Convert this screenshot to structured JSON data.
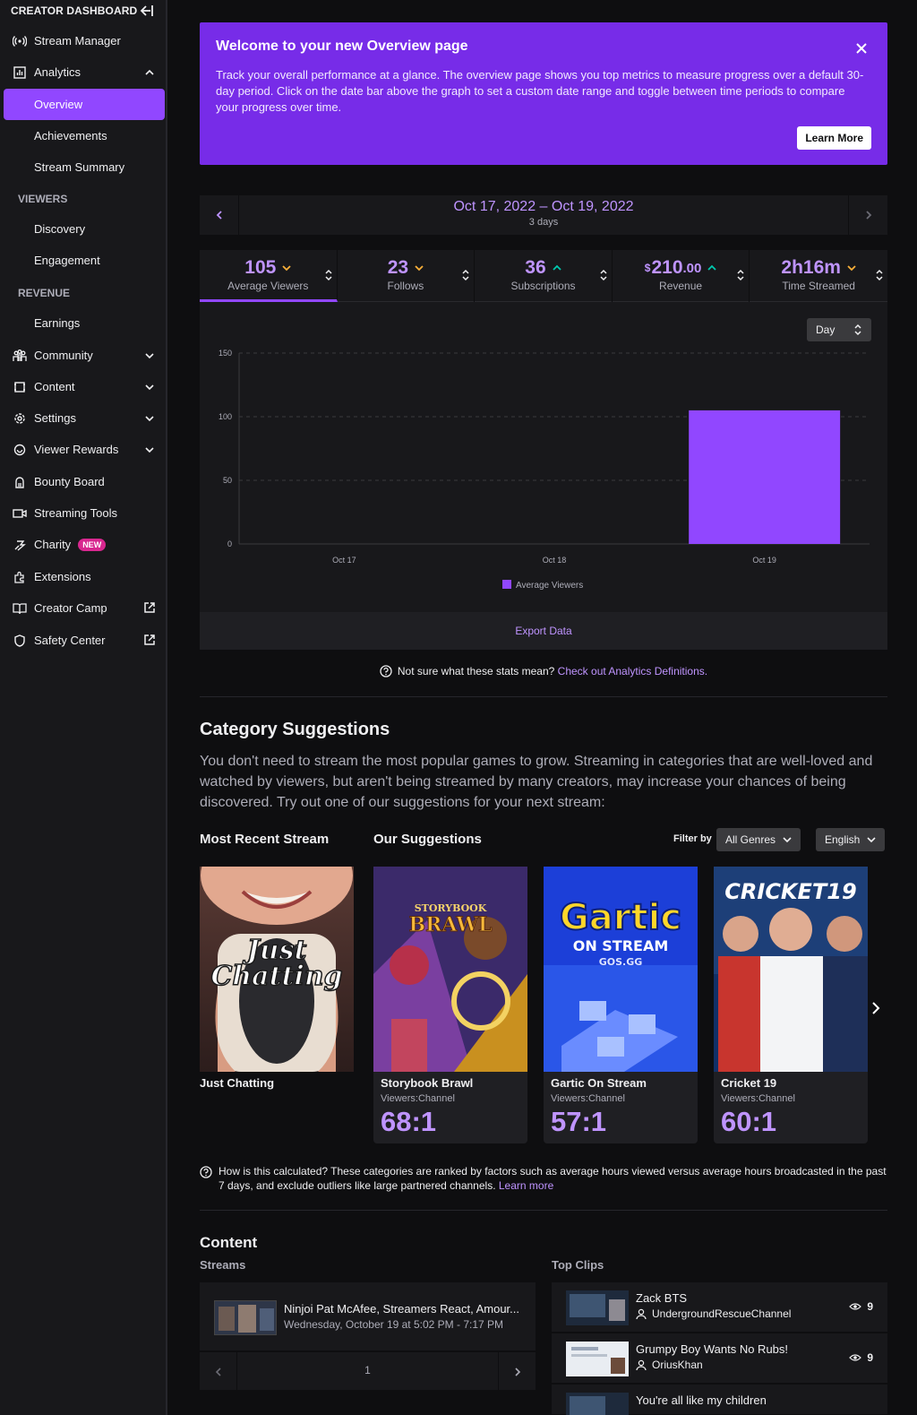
{
  "sidebar": {
    "title": "CREATOR DASHBOARD",
    "stream_manager": "Stream Manager",
    "analytics": "Analytics",
    "overview": "Overview",
    "achievements": "Achievements",
    "stream_summary": "Stream Summary",
    "viewers_cat": "VIEWERS",
    "discovery": "Discovery",
    "engagement": "Engagement",
    "revenue_cat": "REVENUE",
    "earnings": "Earnings",
    "community": "Community",
    "content": "Content",
    "settings": "Settings",
    "viewer_rewards": "Viewer Rewards",
    "bounty_board": "Bounty Board",
    "streaming_tools": "Streaming Tools",
    "charity": "Charity",
    "charity_badge": "NEW",
    "extensions": "Extensions",
    "creator_camp": "Creator Camp",
    "safety_center": "Safety Center"
  },
  "welcome": {
    "title": "Welcome to your new Overview page",
    "body": "Track your overall performance at a glance. The overview page shows you top metrics to measure progress over a default 30-day period. Click on the date bar above the graph to set a custom date range and toggle between time periods to compare your progress over time.",
    "learn_more": "Learn More"
  },
  "datebar": {
    "range": "Oct 17, 2022 – Oct 19, 2022",
    "days": "3 days"
  },
  "metrics": [
    {
      "value": "105",
      "label": "Average Viewers",
      "trend": "down"
    },
    {
      "value": "23",
      "label": "Follows",
      "trend": "down"
    },
    {
      "value": "36",
      "label": "Subscriptions",
      "trend": "up"
    },
    {
      "currency": "$",
      "value": "210",
      "decimals": ".00",
      "label": "Revenue",
      "trend": "up"
    },
    {
      "value": "2h16m",
      "label": "Time Streamed",
      "trend": "down"
    }
  ],
  "colors": {
    "accent": "#9147ff",
    "accent_light": "#bf94ff",
    "up": "#00c8af",
    "down": "#fab039"
  },
  "interval_select": "Day",
  "chart_data": {
    "type": "bar",
    "categories": [
      "Oct 17",
      "Oct 18",
      "Oct 19"
    ],
    "series": [
      {
        "name": "Average Viewers",
        "values": [
          0,
          0,
          105
        ]
      }
    ],
    "ylim": [
      0,
      150
    ],
    "yticks": [
      0,
      50,
      100,
      150
    ],
    "grid": true,
    "legend": "bottom"
  },
  "export_label": "Export Data",
  "help_stats": {
    "text": "Not sure what these stats mean?",
    "link": "Check out Analytics Definitions."
  },
  "category": {
    "title": "Category Suggestions",
    "desc": "You don't need to stream the most popular games to grow. Streaming in categories that are well-loved and watched by viewers, but aren't being streamed by many creators, may increase your chances of being discovered. Try out one of our suggestions for your next stream:",
    "most_recent": "Most Recent Stream",
    "our_suggestions": "Our Suggestions",
    "filter_by": "Filter by",
    "genre": "All Genres",
    "language": "English",
    "recent_name": "Just Chatting",
    "recent_art_line1": "Just",
    "recent_art_line2": "Chatting",
    "suggestions": [
      {
        "name": "Storybook Brawl",
        "sub": "Viewers:Channel",
        "ratio": "68:1",
        "art1": "STORYBOOK",
        "art2": "BRAWL"
      },
      {
        "name": "Gartic On Stream",
        "sub": "Viewers:Channel",
        "ratio": "57:1",
        "art1": "Gartic",
        "art2": "ON STREAM",
        "art3": "GOS.GG"
      },
      {
        "name": "Cricket 19",
        "sub": "Viewers:Channel",
        "ratio": "60:1",
        "art1": "CRICKET19"
      }
    ]
  },
  "help_calc": {
    "text": "How is this calculated? These categories are ranked by factors such as average hours viewed versus average hours broadcasted in the past 7 days, and exclude outliers like large partnered channels.",
    "link": "Learn more"
  },
  "content": {
    "title": "Content",
    "streams_label": "Streams",
    "clips_label": "Top Clips",
    "stream": {
      "title": "Ninjoi Pat McAfee, Streamers React, Amour...",
      "date": "Wednesday, October 19 at 5:02 PM - 7:17 PM"
    },
    "page": "1",
    "clips": [
      {
        "title": "Zack BTS",
        "user": "UndergroundRescueChannel",
        "views": "9"
      },
      {
        "title": "Grumpy Boy Wants No Rubs!",
        "user": "OriusKhan",
        "views": "9"
      },
      {
        "title": "You're all like my children",
        "user": "",
        "views": ""
      }
    ]
  }
}
